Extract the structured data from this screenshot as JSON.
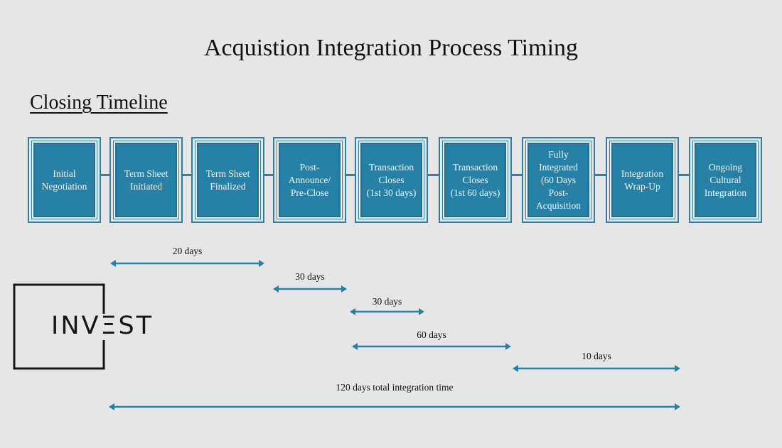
{
  "title": "Acquistion Integration Process Timing",
  "subtitle": "Closing Timeline",
  "colors": {
    "accent": "#2780a6",
    "accent_dark": "#1f6f92",
    "background": "#e6e6e6",
    "text": "#111111"
  },
  "steps": [
    {
      "label": "Initial\nNegotiation"
    },
    {
      "label": "Term Sheet\nInitiated"
    },
    {
      "label": "Term Sheet\nFinalized"
    },
    {
      "label": "Post-\nAnnounce/\nPre-Close"
    },
    {
      "label": "Transaction\nCloses\n(1st 30 days)"
    },
    {
      "label": "Transaction\nCloses\n(1st 60 days)"
    },
    {
      "label": "Fully\nIntegrated\n(60 Days\nPost-\nAcquisition"
    },
    {
      "label": "Integration\nWrap-Up"
    },
    {
      "label": "Ongoing\nCultural\nIntegration"
    }
  ],
  "spans": [
    {
      "label": "20 days",
      "from_step": 1,
      "to_step": 3
    },
    {
      "label": "30 days",
      "from_step": 3,
      "to_step": 4
    },
    {
      "label": "30 days",
      "from_step": 4,
      "to_step": 5
    },
    {
      "label": "60 days",
      "from_step": 4,
      "to_step": 6
    },
    {
      "label": "10 days",
      "from_step": 6,
      "to_step": 8
    },
    {
      "label": "120 days total integration time",
      "from_step": 1,
      "to_step": 8
    }
  ],
  "logo": {
    "text": "INVΞST",
    "icon": "bracket-frame-icon"
  }
}
